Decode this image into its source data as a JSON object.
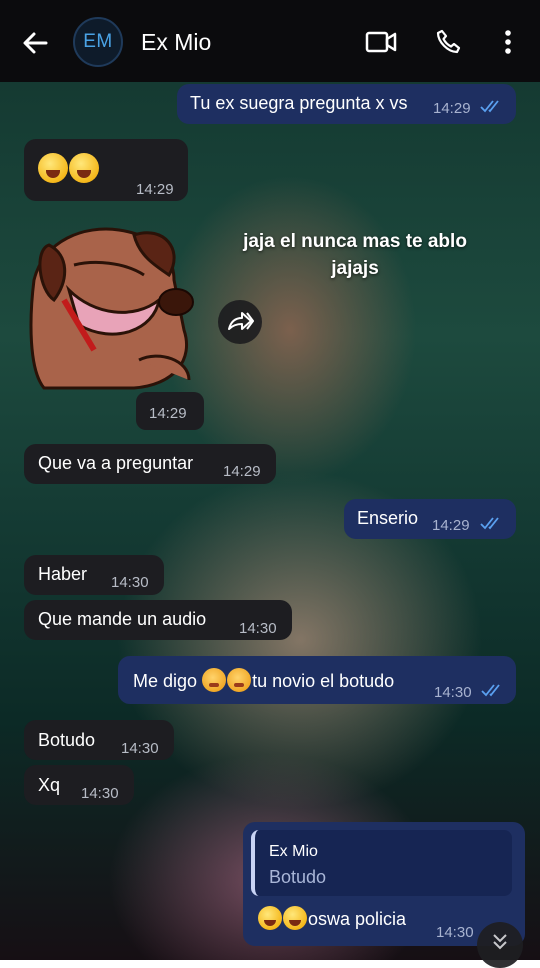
{
  "header": {
    "avatar_initials": "EM",
    "contact_name": "Ex Mio",
    "icons": [
      "back-arrow-icon",
      "video-call-icon",
      "phone-icon",
      "more-options-icon"
    ]
  },
  "messages": [
    {
      "id": "m1",
      "direction": "out",
      "text": "Tu ex suegra pregunta x vs",
      "time": "14:29",
      "read": true
    },
    {
      "id": "m2",
      "direction": "in",
      "type": "emoji",
      "emojis": [
        "rolling-on-floor-laughing",
        "face-with-tears-of-joy"
      ],
      "time": "14:29"
    },
    {
      "id": "m3",
      "direction": "in",
      "type": "sticker",
      "sticker": "laughing-cartoon-dog",
      "time": "14:29"
    },
    {
      "id": "m4",
      "direction": "in",
      "text": "Que va a preguntar",
      "time": "14:29"
    },
    {
      "id": "m5",
      "direction": "out",
      "text": "Enserio",
      "time": "14:29",
      "read": true
    },
    {
      "id": "m6",
      "direction": "in",
      "text": "Haber",
      "time": "14:30"
    },
    {
      "id": "m7",
      "direction": "in",
      "text": "Que mande un audio",
      "time": "14:30"
    },
    {
      "id": "m8",
      "direction": "out",
      "text_before": "Me digo",
      "emojis": [
        "shy-face",
        "shy-face"
      ],
      "text_after": "tu novio el botudo",
      "time": "14:30",
      "read": true
    },
    {
      "id": "m9",
      "direction": "in",
      "text": "Botudo",
      "time": "14:30"
    },
    {
      "id": "m10",
      "direction": "in",
      "text": "Xq",
      "time": "14:30"
    },
    {
      "id": "m11",
      "direction": "out",
      "reply_to": {
        "author": "Ex Mio",
        "text": "Botudo"
      },
      "emojis": [
        "rolling-on-floor-laughing",
        "rolling-on-floor-laughing"
      ],
      "text": "oswa policia",
      "time": "14:30"
    }
  ],
  "overlay_caption": "jaja el nunca mas te ablo jajajs",
  "colors": {
    "outgoing_bubble": "#1e2f61",
    "incoming_bubble": "#1d1d21",
    "read_ticks": "#5aa0f0",
    "header_bg": "#0b0b0d",
    "avatar_text": "#4aa3e6"
  }
}
